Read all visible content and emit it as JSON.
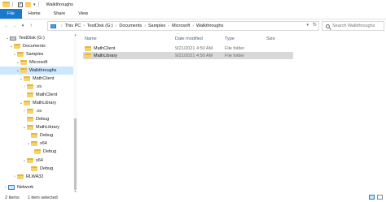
{
  "window": {
    "title": "Walkthroughs"
  },
  "ribbon": {
    "tabs": [
      "File",
      "Home",
      "Share",
      "View"
    ]
  },
  "address": {
    "crumbs": [
      "This PC",
      "TestDisk (G:)",
      "Documents",
      "Samples",
      "Microsoft",
      "Walkthroughs"
    ]
  },
  "search": {
    "placeholder": "Search Walkthroughs"
  },
  "nav": {
    "items": [
      {
        "label": "TestDisk (G:)",
        "chevron": "down",
        "icon": "drive"
      },
      {
        "label": "Documents",
        "chevron": "down",
        "icon": "folder"
      },
      {
        "label": "Samples",
        "chevron": "down",
        "icon": "folder"
      },
      {
        "label": "Microsoft",
        "chevron": "down",
        "icon": "folder"
      },
      {
        "label": "Walkthroughs",
        "chevron": "down",
        "icon": "folder",
        "selected": true
      },
      {
        "label": "MathClient",
        "chevron": "down",
        "icon": "folder"
      },
      {
        "label": ".vs",
        "chevron": "right",
        "icon": "folder"
      },
      {
        "label": "MathClient",
        "chevron": "",
        "icon": "folder"
      },
      {
        "label": "MathLibrary",
        "chevron": "down",
        "icon": "folder"
      },
      {
        "label": ".vs",
        "chevron": "right",
        "icon": "folder"
      },
      {
        "label": "Debug",
        "chevron": "",
        "icon": "folder"
      },
      {
        "label": "MathLibrary",
        "chevron": "down",
        "icon": "folder"
      },
      {
        "label": "Debug",
        "chevron": "",
        "icon": "folder"
      },
      {
        "label": "x64",
        "chevron": "down",
        "icon": "folder"
      },
      {
        "label": "Debug",
        "chevron": "",
        "icon": "folder"
      },
      {
        "label": "x64",
        "chevron": "down",
        "icon": "folder"
      },
      {
        "label": "Debug",
        "chevron": "",
        "icon": "folder"
      },
      {
        "label": "RLWA32",
        "chevron": "right",
        "icon": "folder"
      },
      {
        "label": "Network",
        "chevron": "right",
        "icon": "network"
      }
    ]
  },
  "columns": {
    "name": "Name",
    "date": "Date modified",
    "type": "Type",
    "size": "Size"
  },
  "files": [
    {
      "name": "MathClient",
      "date": "9/21/2021 4:50 AM",
      "type": "File folder",
      "selected": false
    },
    {
      "name": "MathLibrary",
      "date": "9/21/2021 4:50 AM",
      "type": "File folder",
      "selected": true
    }
  ],
  "status": {
    "count": "2 items",
    "selected": "1 item selected"
  }
}
